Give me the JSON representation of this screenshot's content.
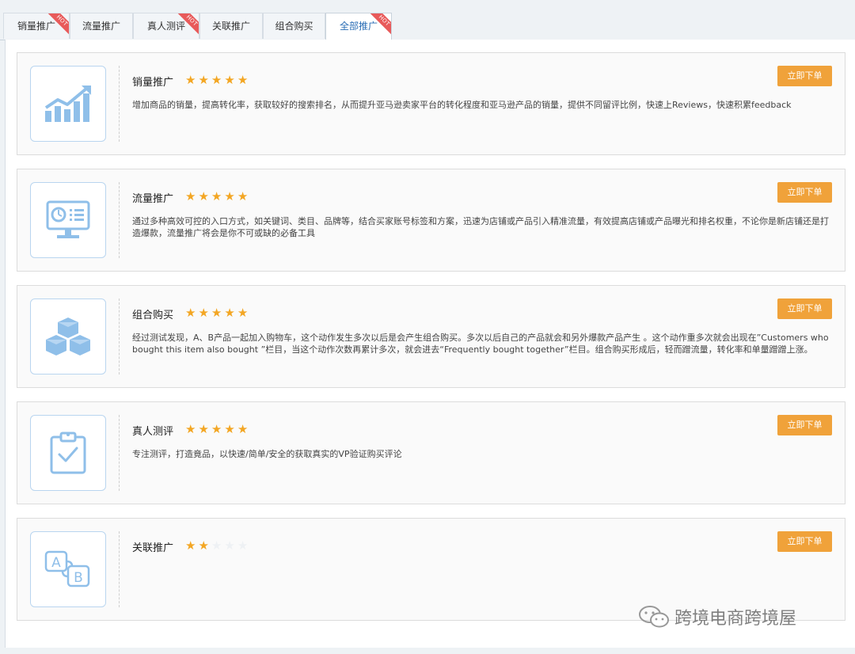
{
  "tabs": [
    {
      "label": "销量推广",
      "hot": true,
      "active": false
    },
    {
      "label": "流量推广",
      "hot": false,
      "active": false
    },
    {
      "label": "真人测评",
      "hot": true,
      "active": false
    },
    {
      "label": "关联推广",
      "hot": false,
      "active": false
    },
    {
      "label": "组合购买",
      "hot": false,
      "active": false
    },
    {
      "label": "全部推广",
      "hot": true,
      "active": true
    }
  ],
  "hot_badge": "HOT",
  "order_button_label": "立即下单",
  "cards": [
    {
      "title": "销量推广",
      "rating": 5,
      "icon": "growth-chart-icon",
      "description": "增加商品的销量，提高转化率，获取较好的搜索排名，从而提升亚马逊卖家平台的转化程度和亚马逊产品的销量，提供不同留评比例，快速上Reviews，快速积累feedback"
    },
    {
      "title": "流量推广",
      "rating": 5,
      "icon": "monitor-analytics-icon",
      "description": "通过多种高效可控的入口方式，如关键词、类目、品牌等，结合买家账号标签和方案，迅速为店铺或产品引入精准流量，有效提高店铺或产品曝光和排名权重，不论你是新店铺还是打造爆款，流量推广将会是你不可或缺的必备工具"
    },
    {
      "title": "组合购买",
      "rating": 5,
      "icon": "stacked-boxes-icon",
      "description": "经过测试发现，A、B产品一起加入购物车，这个动作发生多次以后是会产生组合购买。多次以后自己的产品就会和另外爆款产品产生 。这个动作重多次就会出现在”Customers who bought this item also bought ”栏目，当这个动作次数再累计多次，就会进去“Frequently bought together”栏目。组合购买形成后，轻而蹭流量，转化率和单量蹭蹭上涨。"
    },
    {
      "title": "真人测评",
      "rating": 5,
      "icon": "clipboard-check-icon",
      "description": "专注测评，打造竟品，以快速/简单/安全的获取真实的VP验证购买评论"
    },
    {
      "title": "关联推广",
      "rating": 2,
      "icon": "ab-link-icon",
      "description": ""
    }
  ],
  "watermark": {
    "text": "跨境电商跨境屋",
    "icon": "wechat-icon"
  }
}
